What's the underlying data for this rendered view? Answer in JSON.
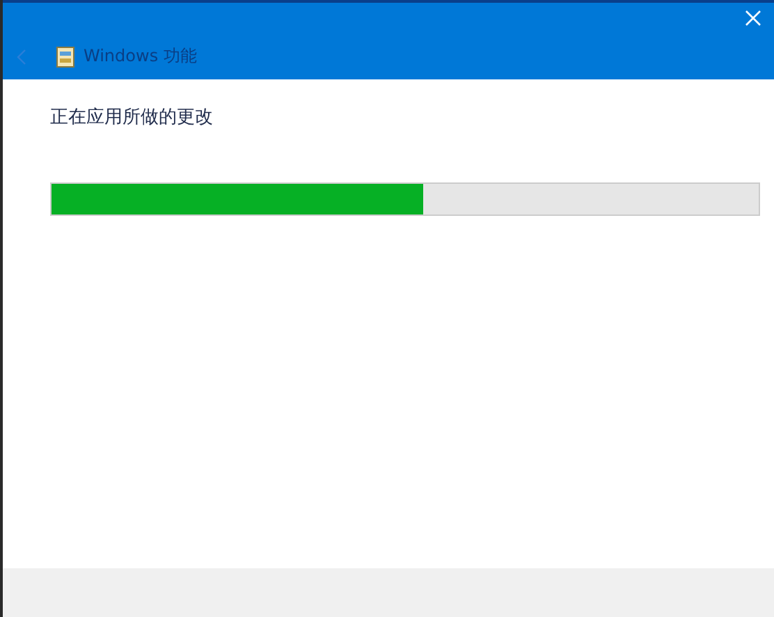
{
  "window": {
    "title": "Windows 功能"
  },
  "heading": "正在应用所做的更改",
  "progress": {
    "level": 0.525
  }
}
